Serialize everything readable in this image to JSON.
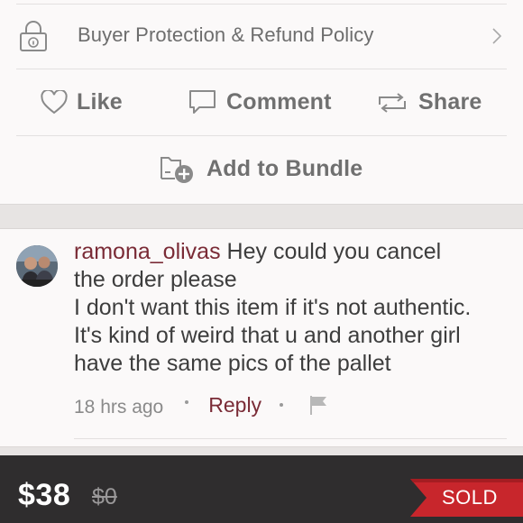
{
  "policy": {
    "label": "Buyer Protection & Refund Policy",
    "icon": "lock-icon"
  },
  "actions": {
    "like": "Like",
    "comment": "Comment",
    "share": "Share"
  },
  "bundle": {
    "label": "Add to Bundle"
  },
  "comment": {
    "username": "ramona_olivas",
    "lines": [
      "Hey could you cancel",
      "the order please",
      "I don't want this item if it's not authentic.",
      "It's kind of weird that u and another girl",
      "have the same pics of the pallet"
    ],
    "time": "18 hrs ago",
    "reply": "Reply"
  },
  "listing": {
    "price": "$38",
    "original_price": "$0",
    "status": "SOLD"
  },
  "colors": {
    "brand_maroon": "#7a2b36",
    "sold_red": "#c8262c",
    "bottom_bar": "#2f2d2e"
  }
}
